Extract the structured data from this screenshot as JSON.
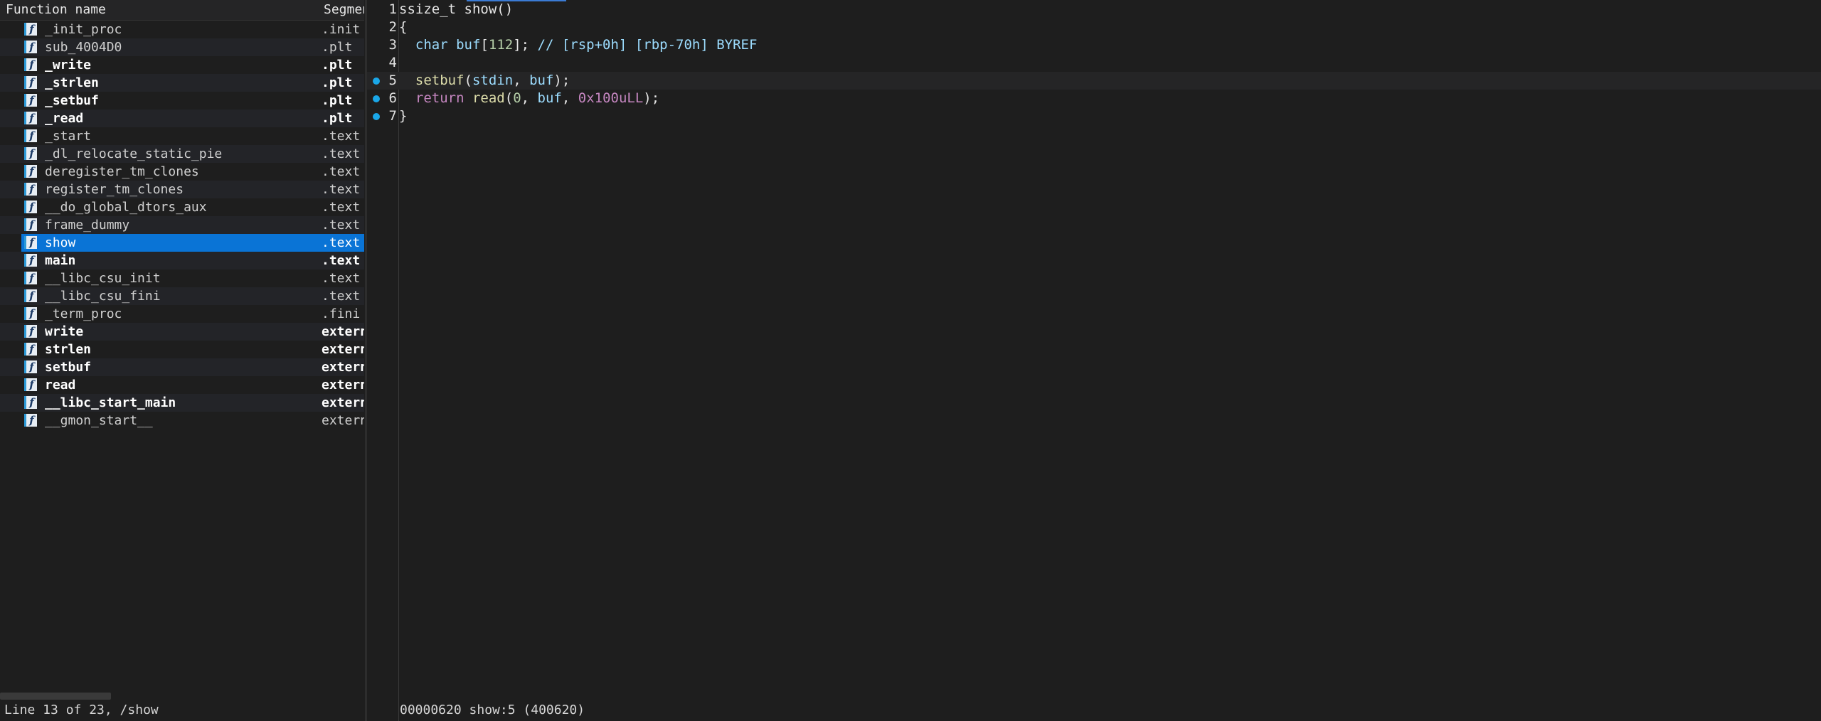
{
  "functions": {
    "header": {
      "name_label": "Function name",
      "segment_label": "Segment"
    },
    "rows": [
      {
        "name": "_init_proc",
        "segment": ".init",
        "bold": false
      },
      {
        "name": "sub_4004D0",
        "segment": ".plt",
        "bold": false
      },
      {
        "name": "_write",
        "segment": ".plt",
        "bold": true
      },
      {
        "name": "_strlen",
        "segment": ".plt",
        "bold": true
      },
      {
        "name": "_setbuf",
        "segment": ".plt",
        "bold": true
      },
      {
        "name": "_read",
        "segment": ".plt",
        "bold": true
      },
      {
        "name": "_start",
        "segment": ".text",
        "bold": false
      },
      {
        "name": "_dl_relocate_static_pie",
        "segment": ".text",
        "bold": false
      },
      {
        "name": "deregister_tm_clones",
        "segment": ".text",
        "bold": false
      },
      {
        "name": "register_tm_clones",
        "segment": ".text",
        "bold": false
      },
      {
        "name": "__do_global_dtors_aux",
        "segment": ".text",
        "bold": false
      },
      {
        "name": "frame_dummy",
        "segment": ".text",
        "bold": false
      },
      {
        "name": "show",
        "segment": ".text",
        "bold": false,
        "selected": true
      },
      {
        "name": "main",
        "segment": ".text",
        "bold": true
      },
      {
        "name": "__libc_csu_init",
        "segment": ".text",
        "bold": false
      },
      {
        "name": "__libc_csu_fini",
        "segment": ".text",
        "bold": false
      },
      {
        "name": "_term_proc",
        "segment": ".fini",
        "bold": false
      },
      {
        "name": "write",
        "segment": "extern",
        "bold": true
      },
      {
        "name": "strlen",
        "segment": "extern",
        "bold": true
      },
      {
        "name": "setbuf",
        "segment": "extern",
        "bold": true
      },
      {
        "name": "read",
        "segment": "extern",
        "bold": true
      },
      {
        "name": "__libc_start_main",
        "segment": "extern",
        "bold": true
      },
      {
        "name": "__gmon_start__",
        "segment": "extern",
        "bold": false
      }
    ],
    "icon_glyph": "f",
    "icon_name": "function-icon",
    "status": "Line 13 of 23, /show"
  },
  "pseudocode": {
    "lines": [
      {
        "num": "1",
        "breakpoint": false,
        "current": false,
        "tokens": [
          [
            "plain",
            "ssize_t show()"
          ]
        ]
      },
      {
        "num": "2",
        "breakpoint": false,
        "current": false,
        "tokens": [
          [
            "plain",
            "{"
          ]
        ]
      },
      {
        "num": "3",
        "breakpoint": false,
        "current": false,
        "tokens": [
          [
            "plain",
            "  "
          ],
          [
            "type",
            "char"
          ],
          [
            "plain",
            " "
          ],
          [
            "var",
            "buf"
          ],
          [
            "plain",
            "["
          ],
          [
            "num",
            "112"
          ],
          [
            "plain",
            "]; "
          ],
          [
            "cmt",
            "// [rsp+0h] [rbp-70h] BYREF"
          ]
        ]
      },
      {
        "num": "4",
        "breakpoint": false,
        "current": false,
        "tokens": [
          [
            "plain",
            ""
          ]
        ]
      },
      {
        "num": "5",
        "breakpoint": true,
        "current": true,
        "tokens": [
          [
            "plain",
            "  "
          ],
          [
            "fn",
            "setbuf"
          ],
          [
            "plain",
            "("
          ],
          [
            "var",
            "stdin"
          ],
          [
            "plain",
            ", "
          ],
          [
            "var",
            "buf"
          ],
          [
            "plain",
            ");"
          ]
        ]
      },
      {
        "num": "6",
        "breakpoint": true,
        "current": false,
        "tokens": [
          [
            "plain",
            "  "
          ],
          [
            "kw",
            "return"
          ],
          [
            "plain",
            " "
          ],
          [
            "fn",
            "read"
          ],
          [
            "plain",
            "("
          ],
          [
            "num",
            "0"
          ],
          [
            "plain",
            ", "
          ],
          [
            "var",
            "buf"
          ],
          [
            "plain",
            ", "
          ],
          [
            "hex",
            "0x100uLL"
          ],
          [
            "plain",
            ");"
          ]
        ]
      },
      {
        "num": "7",
        "breakpoint": true,
        "current": false,
        "tokens": [
          [
            "plain",
            "}"
          ]
        ]
      }
    ],
    "status": "00000620 show:5 (400620)"
  }
}
